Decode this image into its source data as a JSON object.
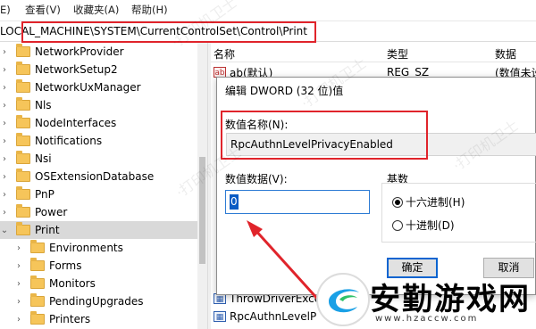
{
  "menubar": {
    "items": [
      "E)",
      "查看(V)",
      "收藏夹(A)",
      "帮助(H)"
    ]
  },
  "address": {
    "path": "LOCAL_MACHINE\\SYSTEM\\CurrentControlSet\\Control\\Print"
  },
  "tree": {
    "items": [
      {
        "label": "NetworkProvider",
        "expanded": false
      },
      {
        "label": "NetworkSetup2",
        "expanded": false
      },
      {
        "label": "NetworkUxManager",
        "expanded": false
      },
      {
        "label": "Nls",
        "expanded": false
      },
      {
        "label": "NodeInterfaces",
        "expanded": false
      },
      {
        "label": "Notifications",
        "expanded": false
      },
      {
        "label": "Nsi",
        "expanded": false
      },
      {
        "label": "OSExtensionDatabase",
        "expanded": false
      },
      {
        "label": "PnP",
        "expanded": false
      },
      {
        "label": "Power",
        "expanded": false
      },
      {
        "label": "Print",
        "expanded": true,
        "selected": true
      },
      {
        "label": "Environments",
        "expanded": false,
        "child": true
      },
      {
        "label": "Forms",
        "expanded": false,
        "child": true
      },
      {
        "label": "Monitors",
        "expanded": false,
        "child": true
      },
      {
        "label": "PendingUpgrades",
        "expanded": false,
        "child": true
      },
      {
        "label": "Printers",
        "expanded": false,
        "child": true
      }
    ]
  },
  "list": {
    "headers": {
      "name": "名称",
      "type": "类型",
      "data": "数据"
    },
    "rows": [
      {
        "icon": "ab",
        "name": "ab(默认)",
        "type": "REG_SZ",
        "data": "(数值未设"
      },
      {
        "icon": "dword",
        "name": "ThrowDriverExce",
        "type": "",
        "data": ""
      },
      {
        "icon": "dword",
        "name": "RpcAuthnLevelP",
        "type": "",
        "data": ""
      }
    ]
  },
  "dialog": {
    "title": "编辑 DWORD (32 位)值",
    "name_label": "数值名称(N):",
    "name_value": "RpcAuthnLevelPrivacyEnabled",
    "data_label": "数值数据(V):",
    "data_value": "0",
    "base_label": "基数",
    "radio_hex": "十六进制(H)",
    "radio_dec": "十进制(D)",
    "hex_selected": true,
    "ok_label": "确定",
    "cancel_label": "取消"
  },
  "watermark": {
    "logo_text": "安勤游戏网",
    "logo_url": "www.hzaccw.com"
  },
  "colors": {
    "highlight": "#e0242b",
    "selection": "#0a5bc4"
  }
}
